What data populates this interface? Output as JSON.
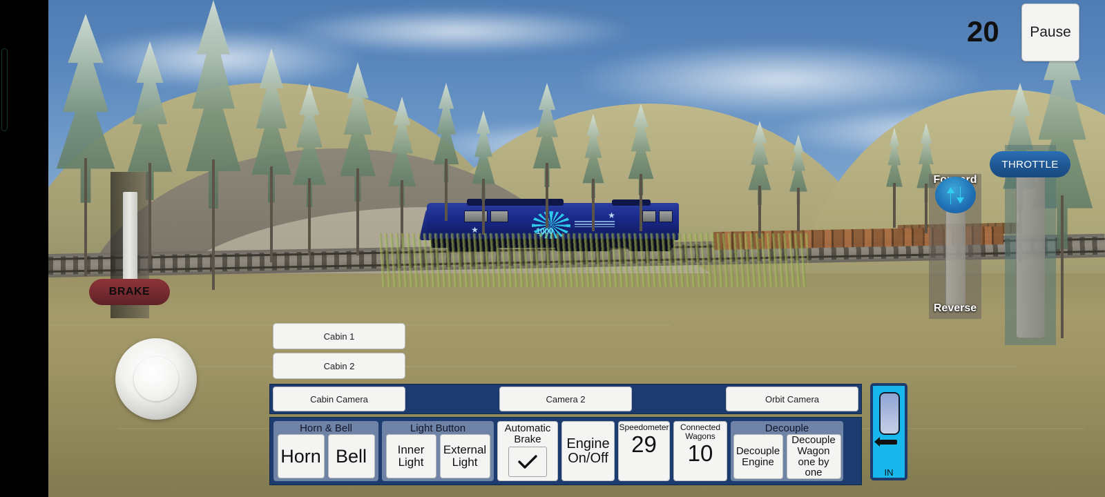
{
  "hud": {
    "score": "20",
    "pause_label": "Pause"
  },
  "brake": {
    "label": "BRAKE"
  },
  "joystick": {
    "name": "movement-joystick"
  },
  "cabin_buttons": [
    {
      "label": "Cabin 1"
    },
    {
      "label": "Cabin 2"
    }
  ],
  "camera_bar": {
    "buttons": [
      {
        "label": "Cabin Camera"
      },
      {
        "label": "Camera 2"
      },
      {
        "label": "Orbit Camera"
      }
    ]
  },
  "control_panel": {
    "horn_bell": {
      "title": "Horn & Bell",
      "buttons": [
        {
          "label": "Horn"
        },
        {
          "label": "Bell"
        }
      ]
    },
    "light_button": {
      "title": "Light Button",
      "buttons": [
        {
          "label": "Inner Light"
        },
        {
          "label": "External Light"
        }
      ]
    },
    "automatic_brake": {
      "label": "Automatic Brake",
      "checked": true
    },
    "engine": {
      "label": "Engine On/Off"
    },
    "speedometer": {
      "label": "Speedometer",
      "value": "29"
    },
    "connected_wagons": {
      "label": "Connected Wagons",
      "value": "10"
    },
    "decouple": {
      "title": "Decouple",
      "buttons": [
        {
          "label": "Decouple Engine"
        },
        {
          "label": "Decouple Wagon one by one"
        }
      ]
    }
  },
  "in_lever": {
    "label": "IN"
  },
  "direction": {
    "forward_label": "Forward",
    "reverse_label": "Reverse"
  },
  "throttle": {
    "label": "THROTTLE"
  },
  "colors": {
    "panel_blue": "#1c3c70",
    "group_blue": "#6f83a6",
    "button_face": "#f4f4f2",
    "brake_red": "#742a2f",
    "throttle_blue": "#1e5693",
    "lever_cyan": "#19b8ec"
  }
}
